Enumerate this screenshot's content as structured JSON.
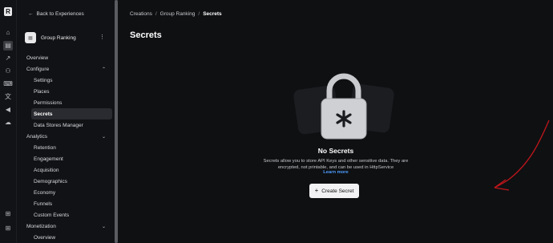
{
  "sidebar": {
    "back_label": "Back to Experiences",
    "experience_name": "Group Ranking",
    "items": [
      {
        "label": "Overview",
        "level": 0
      },
      {
        "label": "Configure",
        "level": 0,
        "expanded": true
      },
      {
        "label": "Settings",
        "level": 1
      },
      {
        "label": "Places",
        "level": 1
      },
      {
        "label": "Permissions",
        "level": 1
      },
      {
        "label": "Secrets",
        "level": 1,
        "active": true
      },
      {
        "label": "Data Stores Manager",
        "level": 1
      },
      {
        "label": "Analytics",
        "level": 0,
        "expanded": true
      },
      {
        "label": "Retention",
        "level": 1
      },
      {
        "label": "Engagement",
        "level": 1
      },
      {
        "label": "Acquisition",
        "level": 1
      },
      {
        "label": "Demographics",
        "level": 1
      },
      {
        "label": "Economy",
        "level": 1
      },
      {
        "label": "Funnels",
        "level": 1
      },
      {
        "label": "Custom Events",
        "level": 1
      },
      {
        "label": "Monetization",
        "level": 0,
        "expanded": true
      },
      {
        "label": "Overview",
        "level": 1
      }
    ]
  },
  "breadcrumb": {
    "items": [
      "Creations",
      "Group Ranking",
      "Secrets"
    ],
    "separator": "/"
  },
  "page": {
    "title": "Secrets",
    "empty_heading": "No Secrets",
    "empty_description": "Secrets allow you to store API Keys and other sensitive data. They are encrypted, not printable, and can be used in HttpService",
    "learn_more": "Learn more",
    "create_button": "Create Secret"
  },
  "icons": {
    "rail": [
      "home-icon",
      "creations-icon",
      "analytics-icon",
      "groups-icon",
      "talent-icon",
      "localization-icon",
      "ads-icon",
      "cloud-icon",
      "windows-icon",
      "windows-icon"
    ]
  },
  "colors": {
    "background": "#0f1012",
    "link": "#4d9dff",
    "annotation_arrow": "#c0161b"
  }
}
